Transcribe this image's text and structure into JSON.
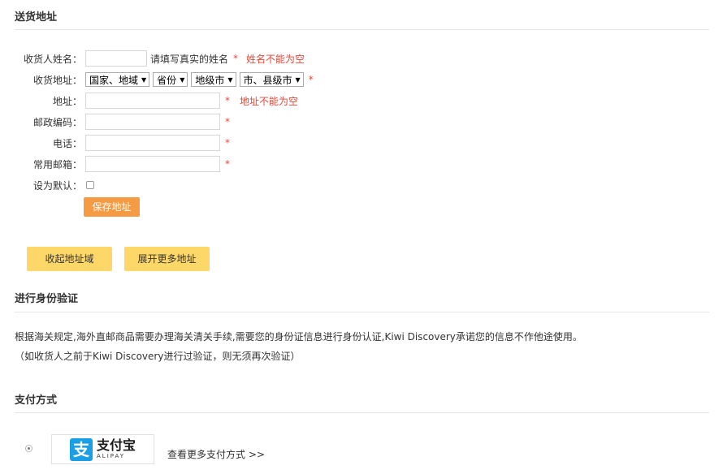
{
  "shipping": {
    "title": "送货地址",
    "name_label": "收货人姓名：",
    "name_value": "",
    "name_hint": "请填写真实的姓名",
    "name_error": "姓名不能为空",
    "region_label": "收货地址：",
    "region_selects": [
      "国家、地域",
      "省份",
      "地级市",
      "市、县级市"
    ],
    "address_label": "地址：",
    "address_value": "",
    "address_error": "地址不能为空",
    "postcode_label": "邮政编码：",
    "phone_label": "电话：",
    "email_label": "常用邮箱：",
    "default_label": "设为默认：",
    "required_mark": "*",
    "save_button": "保存地址",
    "collapse_button": "收起地址域",
    "expand_button": "展开更多地址"
  },
  "identity": {
    "title": "进行身份验证",
    "line1": "根据海关规定,海外直邮商品需要办理海关清关手续,需要您的身份证信息进行身份认证,Kiwi Discovery承诺您的信息不作他途使用。",
    "line2": "（如收货人之前于Kiwi Discovery进行过验证，则无须再次验证）"
  },
  "payment": {
    "title": "支付方式",
    "alipay_cn": "支付宝",
    "alipay_en": "ALIPAY",
    "alipay_glyph": "支",
    "more_link": "查看更多支付方式 >>"
  },
  "colors": {
    "error": "#e34a3a",
    "save_button": "#f49b43",
    "yellow_button": "#fdd869",
    "alipay_blue": "#1a9ee6"
  }
}
